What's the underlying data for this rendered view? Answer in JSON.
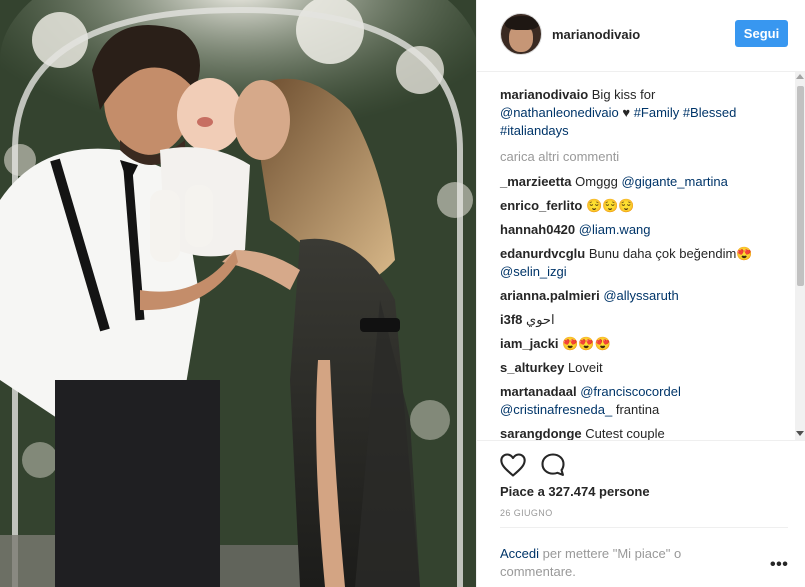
{
  "post": {
    "username": "marianodivaio",
    "follow_label": "Segui",
    "caption": {
      "user": "marianodivaio",
      "text_before": "Big kiss for",
      "mention": "@nathanleonedivaio",
      "heart": "♥",
      "tags_line1": "#Family #Blessed",
      "tags_line2": "#italiandays"
    },
    "load_more": "carica altri commenti",
    "comments": [
      {
        "user": "_marzieetta",
        "text": "Omggg",
        "link": "@gigante_martina"
      },
      {
        "user": "enrico_ferlito",
        "text": "😌😌😌",
        "link": ""
      },
      {
        "user": "hannah0420",
        "text": "",
        "link": "@liam.wang"
      },
      {
        "user": "edanurdvcglu",
        "text": "Bunu daha çok beğendim😍",
        "link": "@selin_izgi"
      },
      {
        "user": "arianna.palmieri",
        "text": "",
        "link": "@allyssaruth"
      },
      {
        "user": "i3f8",
        "text": "احوي",
        "link": ""
      },
      {
        "user": "iam_jacki",
        "text": "😍😍😍",
        "link": ""
      },
      {
        "user": "s_alturkey",
        "text": "Loveit",
        "link": ""
      },
      {
        "user": "martanadaal",
        "text": "",
        "link": "@franciscocordel",
        "link2": "@cristinafresneda_",
        "tail": "frantina"
      },
      {
        "user": "sarangdonge",
        "text": "Cutest couple",
        "link": ""
      }
    ],
    "likes": "Piace a 327.474 persone",
    "date": "26 GIUGNO",
    "login_link": "Accedi",
    "login_text": "per mettere \"Mi piace\" o commentare.",
    "more_options": "•••"
  },
  "icons": {
    "like": "heart-outline-icon",
    "comment": "speech-bubble-icon",
    "more": "ellipsis-icon"
  },
  "colors": {
    "accent": "#3897f0",
    "link": "#003569",
    "muted": "#999999",
    "text": "#262626"
  }
}
